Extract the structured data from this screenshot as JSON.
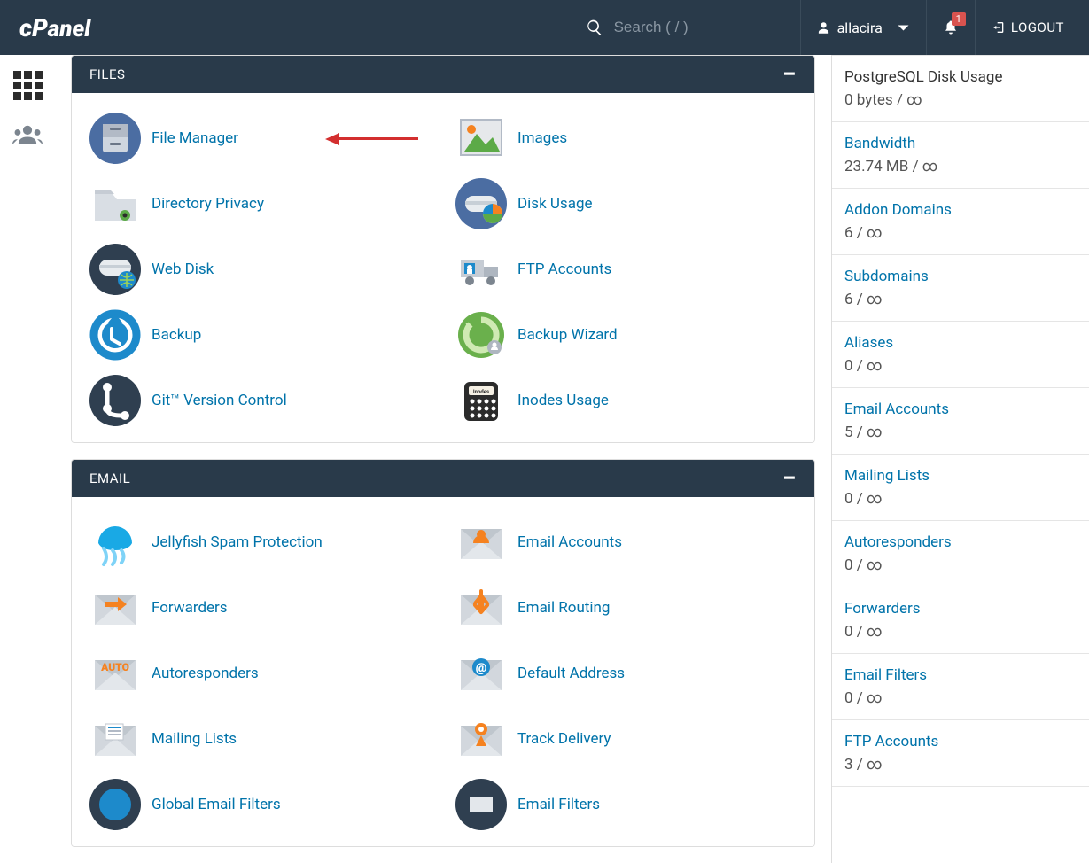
{
  "header": {
    "logo_text": "cPanel",
    "search_placeholder": "Search ( / )",
    "username": "allacira",
    "notification_count": "1",
    "logout_label": "LOGOUT"
  },
  "panels": [
    {
      "title": "FILES",
      "tools": [
        {
          "label": "File Manager",
          "icon": "file-manager",
          "annot_arrow": true
        },
        {
          "label": "Images",
          "icon": "images"
        },
        {
          "label": "Directory Privacy",
          "icon": "dir-privacy"
        },
        {
          "label": "Disk Usage",
          "icon": "disk-usage"
        },
        {
          "label": "Web Disk",
          "icon": "web-disk"
        },
        {
          "label": "FTP Accounts",
          "icon": "ftp"
        },
        {
          "label": "Backup",
          "icon": "backup"
        },
        {
          "label": "Backup Wizard",
          "icon": "backup-wizard"
        },
        {
          "label": "Git™ Version Control",
          "icon": "git"
        },
        {
          "label": "Inodes Usage",
          "icon": "inodes"
        }
      ]
    },
    {
      "title": "EMAIL",
      "tools": [
        {
          "label": "Jellyfish Spam Protection",
          "icon": "jellyfish"
        },
        {
          "label": "Email Accounts",
          "icon": "email-accounts"
        },
        {
          "label": "Forwarders",
          "icon": "forwarders"
        },
        {
          "label": "Email Routing",
          "icon": "email-routing"
        },
        {
          "label": "Autoresponders",
          "icon": "autoresponders"
        },
        {
          "label": "Default Address",
          "icon": "default-address"
        },
        {
          "label": "Mailing Lists",
          "icon": "mailing-lists"
        },
        {
          "label": "Track Delivery",
          "icon": "track-delivery"
        },
        {
          "label": "Global Email Filters",
          "icon": "global-filters"
        },
        {
          "label": "Email Filters",
          "icon": "email-filters"
        }
      ]
    }
  ],
  "stats": [
    {
      "name": "PostgreSQL Disk Usage",
      "value": "0 bytes / ∞",
      "link": false
    },
    {
      "name": "Bandwidth",
      "value": "23.74 MB / ∞",
      "link": true
    },
    {
      "name": "Addon Domains",
      "value": "6 / ∞",
      "link": true
    },
    {
      "name": "Subdomains",
      "value": "6 / ∞",
      "link": true
    },
    {
      "name": "Aliases",
      "value": "0 / ∞",
      "link": true
    },
    {
      "name": "Email Accounts",
      "value": "5 / ∞",
      "link": true
    },
    {
      "name": "Mailing Lists",
      "value": "0 / ∞",
      "link": true
    },
    {
      "name": "Autoresponders",
      "value": "0 / ∞",
      "link": true
    },
    {
      "name": "Forwarders",
      "value": "0 / ∞",
      "link": true
    },
    {
      "name": "Email Filters",
      "value": "0 / ∞",
      "link": true
    },
    {
      "name": "FTP Accounts",
      "value": "3 / ∞",
      "link": true
    }
  ]
}
